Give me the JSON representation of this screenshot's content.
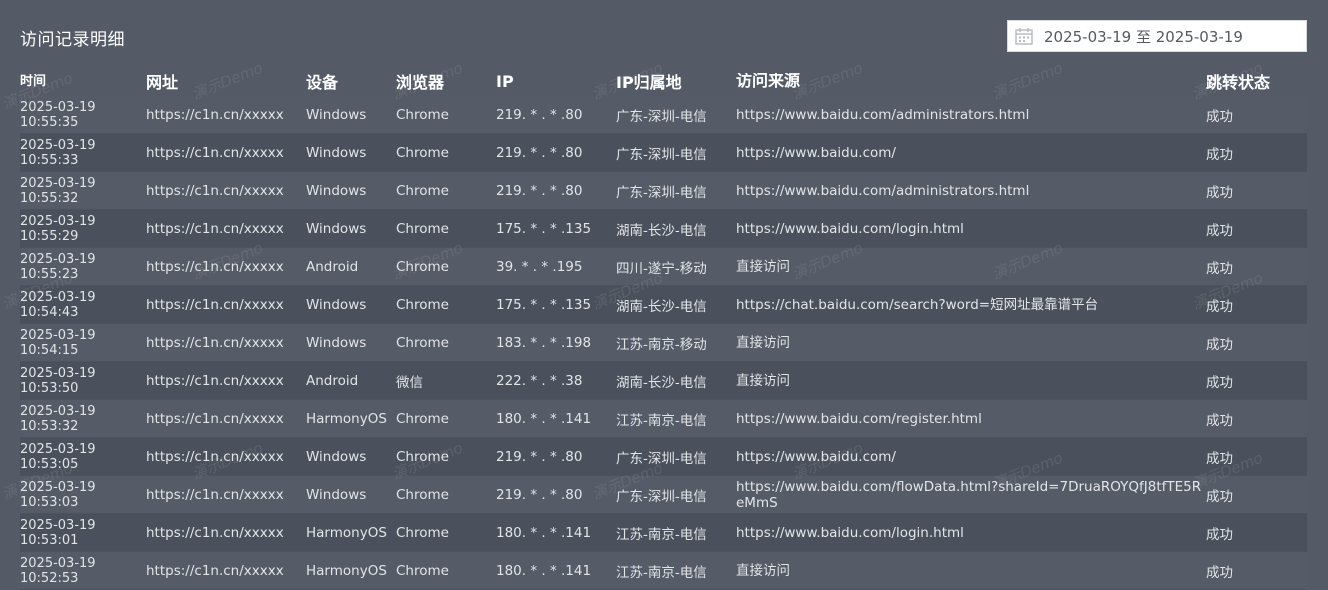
{
  "panel": {
    "title": "访问记录明细"
  },
  "date_range": {
    "value": "2025-03-19 至 2025-03-19"
  },
  "columns": [
    "时间",
    "网址",
    "设备",
    "浏览器",
    "IP",
    "IP归属地",
    "访问来源",
    "跳转状态"
  ],
  "rows": [
    {
      "date": "2025-03-19",
      "time": "10:55:35",
      "url": "https://c1n.cn/xxxxx",
      "device": "Windows",
      "browser": "Chrome",
      "ip": "219. * . * .80",
      "location": "广东-深圳-电信",
      "referer": "https://www.baidu.com/administrators.html",
      "status": "成功"
    },
    {
      "date": "2025-03-19",
      "time": "10:55:33",
      "url": "https://c1n.cn/xxxxx",
      "device": "Windows",
      "browser": "Chrome",
      "ip": "219. * . * .80",
      "location": "广东-深圳-电信",
      "referer": "https://www.baidu.com/",
      "status": "成功"
    },
    {
      "date": "2025-03-19",
      "time": "10:55:32",
      "url": "https://c1n.cn/xxxxx",
      "device": "Windows",
      "browser": "Chrome",
      "ip": "219. * . * .80",
      "location": "广东-深圳-电信",
      "referer": "https://www.baidu.com/administrators.html",
      "status": "成功"
    },
    {
      "date": "2025-03-19",
      "time": "10:55:29",
      "url": "https://c1n.cn/xxxxx",
      "device": "Windows",
      "browser": "Chrome",
      "ip": "175. * . * .135",
      "location": "湖南-长沙-电信",
      "referer": "https://www.baidu.com/login.html",
      "status": "成功"
    },
    {
      "date": "2025-03-19",
      "time": "10:55:23",
      "url": "https://c1n.cn/xxxxx",
      "device": "Android",
      "browser": "Chrome",
      "ip": "39. * . * .195",
      "location": "四川-遂宁-移动",
      "referer": "直接访问",
      "status": "成功"
    },
    {
      "date": "2025-03-19",
      "time": "10:54:43",
      "url": "https://c1n.cn/xxxxx",
      "device": "Windows",
      "browser": "Chrome",
      "ip": "175. * . * .135",
      "location": "湖南-长沙-电信",
      "referer": "https://chat.baidu.com/search?word=短网址最靠谱平台",
      "status": "成功"
    },
    {
      "date": "2025-03-19",
      "time": "10:54:15",
      "url": "https://c1n.cn/xxxxx",
      "device": "Windows",
      "browser": "Chrome",
      "ip": "183. * . * .198",
      "location": "江苏-南京-移动",
      "referer": "直接访问",
      "status": "成功"
    },
    {
      "date": "2025-03-19",
      "time": "10:53:50",
      "url": "https://c1n.cn/xxxxx",
      "device": "Android",
      "browser": "微信",
      "ip": "222. * . * .38",
      "location": "湖南-长沙-电信",
      "referer": "直接访问",
      "status": "成功"
    },
    {
      "date": "2025-03-19",
      "time": "10:53:32",
      "url": "https://c1n.cn/xxxxx",
      "device": "HarmonyOS",
      "browser": "Chrome",
      "ip": "180. * . * .141",
      "location": "江苏-南京-电信",
      "referer": "https://www.baidu.com/register.html",
      "status": "成功"
    },
    {
      "date": "2025-03-19",
      "time": "10:53:05",
      "url": "https://c1n.cn/xxxxx",
      "device": "Windows",
      "browser": "Chrome",
      "ip": "219. * . * .80",
      "location": "广东-深圳-电信",
      "referer": "https://www.baidu.com/",
      "status": "成功"
    },
    {
      "date": "2025-03-19",
      "time": "10:53:03",
      "url": "https://c1n.cn/xxxxx",
      "device": "Windows",
      "browser": "Chrome",
      "ip": "219. * . * .80",
      "location": "广东-深圳-电信",
      "referer": "https://www.baidu.com/flowData.html?shareId=7DruaROYQfJ8tfTE5ReMmS",
      "status": "成功"
    },
    {
      "date": "2025-03-19",
      "time": "10:53:01",
      "url": "https://c1n.cn/xxxxx",
      "device": "HarmonyOS",
      "browser": "Chrome",
      "ip": "180. * . * .141",
      "location": "江苏-南京-电信",
      "referer": "https://www.baidu.com/login.html",
      "status": "成功"
    },
    {
      "date": "2025-03-19",
      "time": "10:52:53",
      "url": "https://c1n.cn/xxxxx",
      "device": "HarmonyOS",
      "browser": "Chrome",
      "ip": "180. * . * .141",
      "location": "江苏-南京-电信",
      "referer": "直接访问",
      "status": "成功"
    }
  ],
  "watermark": {
    "text": "演示Demo"
  },
  "icons": {
    "date_picker": "calendar-icon"
  }
}
